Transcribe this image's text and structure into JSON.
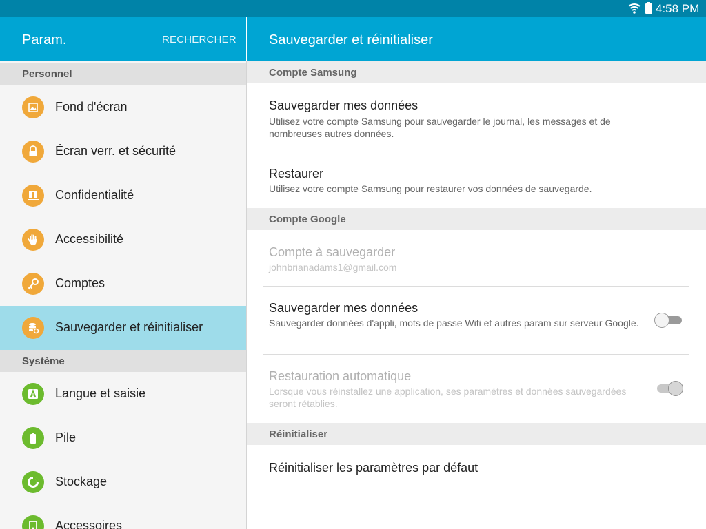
{
  "status_bar": {
    "time": "4:58 PM"
  },
  "left": {
    "title": "Param.",
    "search_label": "RECHERCHER",
    "sections": [
      {
        "header": "Personnel",
        "items": [
          {
            "label": "Fond d'écran",
            "icon": "wallpaper-icon"
          },
          {
            "label": "Écran verr. et sécurité",
            "icon": "lock-icon"
          },
          {
            "label": "Confidentialité",
            "icon": "privacy-icon"
          },
          {
            "label": "Accessibilité",
            "icon": "hand-icon"
          },
          {
            "label": "Comptes",
            "icon": "key-icon"
          },
          {
            "label": "Sauvegarder et réinitialiser",
            "icon": "backup-icon",
            "selected": true
          }
        ]
      },
      {
        "header": "Système",
        "items": [
          {
            "label": "Langue et saisie",
            "icon": "language-icon"
          },
          {
            "label": "Pile",
            "icon": "battery-icon"
          },
          {
            "label": "Stockage",
            "icon": "storage-icon"
          },
          {
            "label": "Accessoires",
            "icon": "accessories-icon"
          }
        ]
      }
    ]
  },
  "right": {
    "title": "Sauvegarder et réinitialiser",
    "categories": {
      "samsung": "Compte Samsung",
      "google": "Compte Google",
      "reset": "Réinitialiser"
    },
    "samsung_backup": {
      "title": "Sauvegarder mes données",
      "summary": "Utilisez votre compte Samsung pour sauvegarder le journal, les messages et de nombreuses autres données."
    },
    "samsung_restore": {
      "title": "Restaurer",
      "summary": "Utilisez votre compte Samsung pour restaurer vos données de sauvegarde."
    },
    "backup_account": {
      "title": "Compte à sauvegarder",
      "summary": "johnbrianadams1@gmail.com",
      "enabled": false
    },
    "google_backup": {
      "title": "Sauvegarder mes données",
      "summary": "Sauvegarder données d'appli, mots de passe Wifi et autres param sur serveur Google.",
      "toggle_on": false
    },
    "auto_restore": {
      "title": "Restauration automatique",
      "summary": "Lorsque vous réinstallez une application, ses paramètres et données sauvegardées seront rétablies.",
      "enabled": false,
      "toggle_on": true
    },
    "factory_reset": {
      "title": "Réinitialiser les paramètres par défaut"
    }
  }
}
